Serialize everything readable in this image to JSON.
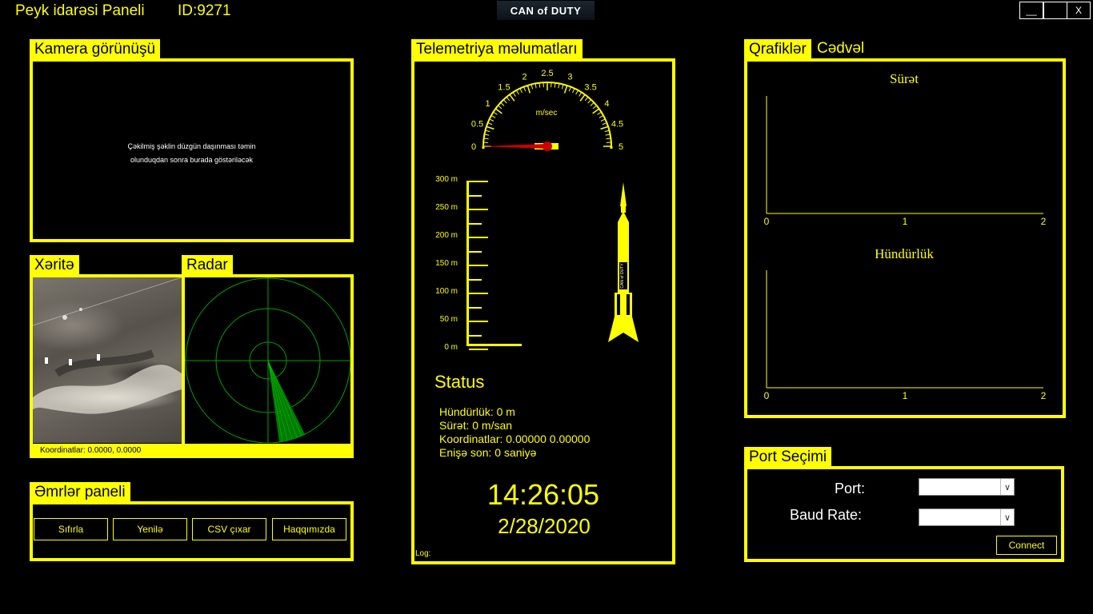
{
  "window": {
    "title": "Peyk idarəsi Paneli",
    "id_label": "ID:9271",
    "logo_text": "CAN of DUTY",
    "btn_minimize": "__",
    "btn_maximize": "",
    "btn_close": "X"
  },
  "camera": {
    "title": "Kamera görünüşü",
    "message_line1": "Çəkilmiş şəklin düzgün daşınması təmin",
    "message_line2": "olunduqdan sonra burada göstəriləcək"
  },
  "map": {
    "title": "Xəritə",
    "coords": "Koordinatlar: 0.0000,  0.0000"
  },
  "radar": {
    "title": "Radar"
  },
  "commands": {
    "title": "Əmrlər paneli",
    "reset": "Sıfırla",
    "refresh": "Yenilə",
    "csv": "CSV çıxar",
    "about": "Haqqımızda"
  },
  "telemetry": {
    "title": "Telemetriya məlumatları",
    "gauge": {
      "unit": "m/sec",
      "ticks": [
        "0",
        "0.5",
        "1",
        "1.5",
        "2",
        "2.5",
        "3",
        "3.5",
        "4",
        "4.5",
        "5"
      ],
      "value": 0
    },
    "altitude_scale": {
      "labels": [
        "300 m",
        "250 m",
        "200 m",
        "150 m",
        "100 m",
        "50 m",
        "0 m"
      ],
      "value": 0
    },
    "rocket_label": "CAN of DUTY",
    "status_title": "Status",
    "altitude_line": "Hündürlük: 0 m",
    "speed_line": "Sürət: 0 m/san",
    "coords_line": "Koordinatlar: 0.00000  0.00000",
    "landing_line": "Enişə son: 0 saniyə",
    "time": "14:26:05",
    "date": "2/28/2020",
    "log_label": "Log:"
  },
  "graphs": {
    "tab_graphs": "Qrafiklər",
    "tab_table": "Cədvəl",
    "chart_data": [
      {
        "type": "line",
        "title": "Sürət",
        "x_ticks": [
          "0",
          "1",
          "2"
        ],
        "xlim": [
          0,
          2
        ],
        "series": []
      },
      {
        "type": "line",
        "title": "Hündürlük",
        "x_ticks": [
          "0",
          "1",
          "2"
        ],
        "xlim": [
          0,
          2
        ],
        "series": []
      }
    ]
  },
  "port": {
    "title": "Port Seçimi",
    "port_label": "Port:",
    "baud_label": "Baud Rate:",
    "port_value": "",
    "baud_value": "",
    "connect": "Connect"
  },
  "colors": {
    "accent": "#ffff00",
    "background": "#000000",
    "radar": "#00a000",
    "needle": "#cc0000"
  }
}
